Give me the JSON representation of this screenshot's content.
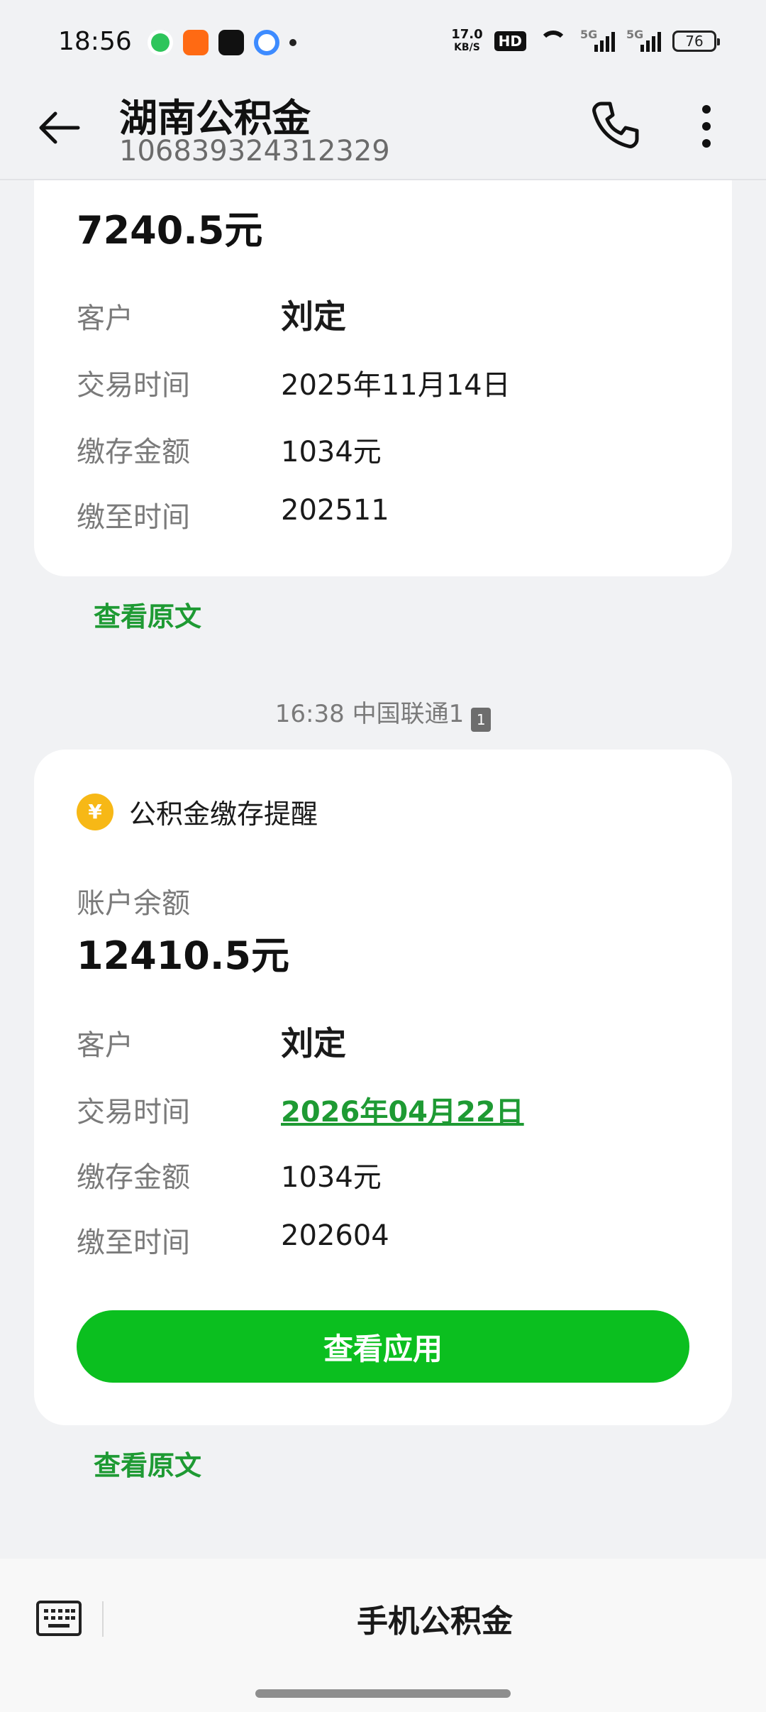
{
  "status_bar": {
    "time": "18:56",
    "net_speed_value": "17.0",
    "net_speed_unit": "KB/S",
    "hd_label": "HD",
    "signal1_label": "5G",
    "signal2_label": "5G",
    "battery": "76"
  },
  "header": {
    "title": "湖南公积金",
    "number": "106839324312329"
  },
  "message1": {
    "balance": "7240.5元",
    "rows": [
      {
        "label": "客户",
        "value": "刘定"
      },
      {
        "label": "交易时间",
        "value": "2025年11月14日"
      },
      {
        "label": "缴存金额",
        "value": "1034元"
      },
      {
        "label": "缴至时间",
        "value": "202511"
      }
    ],
    "view_original": "查看原文"
  },
  "timestamp": {
    "text": "16:38 中国联通1",
    "sim": "1"
  },
  "message2": {
    "title": "公积金缴存提醒",
    "balance_label": "账户余额",
    "balance": "12410.5元",
    "rows": [
      {
        "label": "客户",
        "value": "刘定"
      },
      {
        "label": "交易时间",
        "value": "2026年04月22日"
      },
      {
        "label": "缴存金额",
        "value": "1034元"
      },
      {
        "label": "缴至时间",
        "value": "202604"
      }
    ],
    "action_button": "查看应用",
    "view_original": "查看原文"
  },
  "bottom_bar": {
    "menu_label": "手机公积金"
  },
  "colors": {
    "accent_green": "#0bbf1f",
    "link_green": "#1e9a33",
    "coin_yellow": "#f7b816"
  }
}
